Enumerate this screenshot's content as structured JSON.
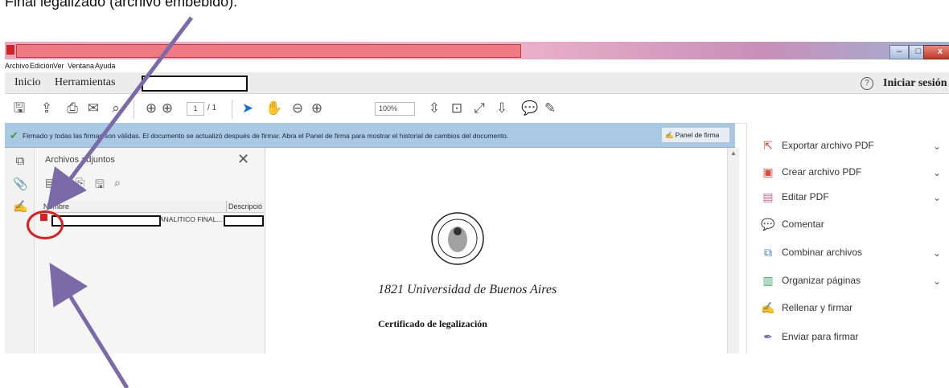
{
  "caption": "Final legalizado (archivo embebido).",
  "window": {
    "minimize": "–",
    "maximize": "□",
    "close": "x"
  },
  "menu": [
    "Archivo",
    "Edición",
    "Ver",
    "Ventana",
    "Ayuda"
  ],
  "tabs": {
    "home": "Inicio",
    "tools": "Herramientas"
  },
  "header": {
    "help": "?",
    "login": "Iniciar sesión"
  },
  "toolbar": {
    "page_current": "1",
    "page_total": "/ 1",
    "zoom": "100%"
  },
  "infobar": {
    "message": "Firmado y todas las firmas son válidas. El documento se actualizó después de firmar. Abra el Panel de firma para mostrar el historial de cambios del documento.",
    "panel_button": "Panel de firma"
  },
  "attachments": {
    "title": "Archivos adjuntos",
    "columns": [
      "Nombre",
      "Descripció"
    ],
    "rows": [
      {
        "name_suffix": "ANALITICO FINAL..."
      }
    ]
  },
  "document": {
    "university": "1821 Universidad de Buenos Aires",
    "heading": "Certificado de legalización",
    "seal_text": "UNIVERSIDAD DE BUENOS AIRES"
  },
  "tools_panel": [
    {
      "label": "Exportar archivo PDF",
      "icon": "export-pdf-icon",
      "color": "#e04a3a",
      "expandable": true
    },
    {
      "label": "Crear archivo PDF",
      "icon": "create-pdf-icon",
      "color": "#e04a3a",
      "expandable": true
    },
    {
      "label": "Editar PDF",
      "icon": "edit-pdf-icon",
      "color": "#e0608a",
      "expandable": true
    },
    {
      "label": "Comentar",
      "icon": "comment-icon",
      "color": "#f2b42e",
      "expandable": false
    },
    {
      "label": "Combinar archivos",
      "icon": "combine-files-icon",
      "color": "#3b7dd8",
      "expandable": true
    },
    {
      "label": "Organizar páginas",
      "icon": "organize-pages-icon",
      "color": "#3aa864",
      "expandable": true
    },
    {
      "label": "Rellenar y firmar",
      "icon": "fill-sign-icon",
      "color": "#7a5bc7",
      "expandable": false
    },
    {
      "label": "Enviar para firmar",
      "icon": "send-for-signature-icon",
      "color": "#7a5bc7",
      "expandable": false
    }
  ]
}
